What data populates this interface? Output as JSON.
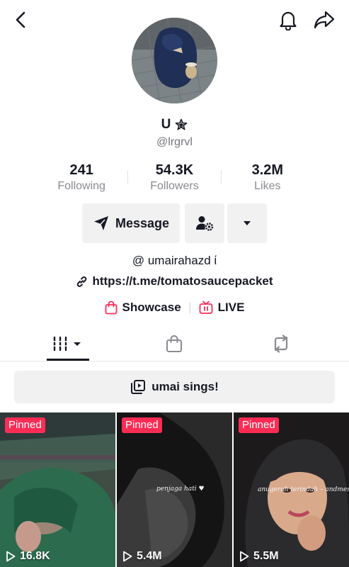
{
  "profile": {
    "display_name": "U",
    "name_badge_icon": "star-outline-icon",
    "handle": "@lrgrvl",
    "bio": "@ umairahazd ί",
    "link": "https://t.me/tomatosaucepacket"
  },
  "stats": [
    {
      "value": "241",
      "label": "Following"
    },
    {
      "value": "54.3K",
      "label": "Followers"
    },
    {
      "value": "3.2M",
      "label": "Likes"
    }
  ],
  "actions": {
    "message_label": "Message",
    "add_friend_icon": "person-gear-icon",
    "more_icon": "caret-down-icon"
  },
  "showcase": {
    "showcase_label": "Showcase",
    "live_label": "LIVE"
  },
  "tabs": [
    {
      "icon": "grid-videos-icon",
      "active": true
    },
    {
      "icon": "shopping-bag-icon",
      "active": false
    },
    {
      "icon": "repost-icon",
      "active": false
    }
  ],
  "playlist": {
    "label": "umai sings!"
  },
  "videos": [
    {
      "badge": "Pinned",
      "views": "16.8K",
      "caption": ""
    },
    {
      "badge": "Pinned",
      "views": "5.4M",
      "caption": "penjaga hati ♥"
    },
    {
      "badge": "Pinned",
      "views": "5.5M",
      "caption": "anugerah terindah – andmesh"
    }
  ],
  "colors": {
    "accent": "#fe2c55",
    "text": "#161823",
    "muted": "#8a8b91",
    "button_bg": "#f1f1f2"
  }
}
